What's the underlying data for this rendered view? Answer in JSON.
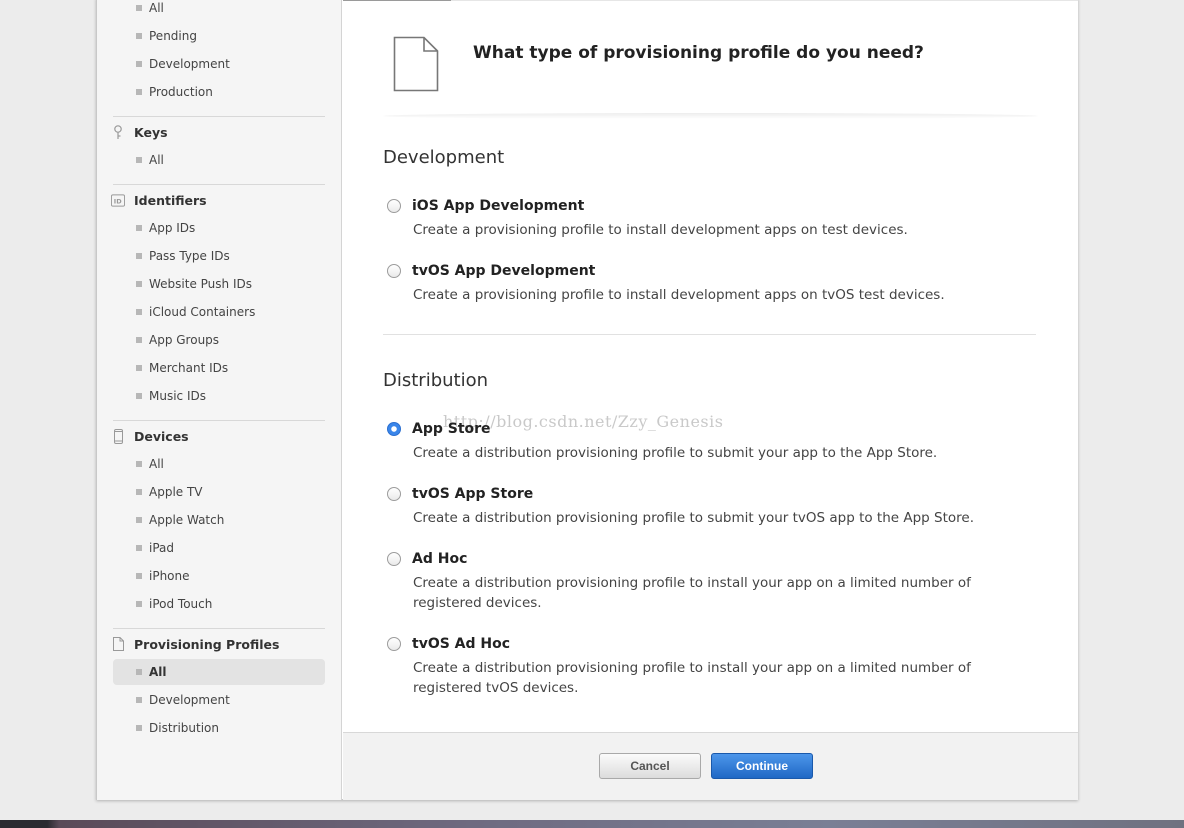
{
  "sidebar": {
    "top_items": [
      "All",
      "Pending",
      "Development",
      "Production"
    ],
    "keys": {
      "heading": "Keys",
      "icon": "key-icon",
      "items": [
        "All"
      ]
    },
    "identifiers": {
      "heading": "Identifiers",
      "icon": "id-badge-icon",
      "items": [
        "App IDs",
        "Pass Type IDs",
        "Website Push IDs",
        "iCloud Containers",
        "App Groups",
        "Merchant IDs",
        "Music IDs"
      ]
    },
    "devices": {
      "heading": "Devices",
      "icon": "device-icon",
      "items": [
        "All",
        "Apple TV",
        "Apple Watch",
        "iPad",
        "iPhone",
        "iPod Touch"
      ]
    },
    "profiles": {
      "heading": "Provisioning Profiles",
      "icon": "document-icon",
      "items": [
        "All",
        "Development",
        "Distribution"
      ],
      "selected": "All"
    }
  },
  "main": {
    "title": "What type of provisioning profile do you need?",
    "development": {
      "heading": "Development",
      "options": [
        {
          "title": "iOS App Development",
          "desc": "Create a provisioning profile to install development apps on test devices.",
          "checked": false
        },
        {
          "title": "tvOS App Development",
          "desc": "Create a provisioning profile to install development apps on tvOS test devices.",
          "checked": false
        }
      ]
    },
    "distribution": {
      "heading": "Distribution",
      "options": [
        {
          "title": "App Store",
          "desc": "Create a distribution provisioning profile to submit your app to the App Store.",
          "checked": true
        },
        {
          "title": "tvOS App Store",
          "desc": "Create a distribution provisioning profile to submit your tvOS app to the App Store.",
          "checked": false
        },
        {
          "title": "Ad Hoc",
          "desc": "Create a distribution provisioning profile to install your app on a limited number of registered devices.",
          "checked": false
        },
        {
          "title": "tvOS Ad Hoc",
          "desc": "Create a distribution provisioning profile to install your app on a limited number of registered tvOS devices.",
          "checked": false
        }
      ]
    },
    "watermark": "http://blog.csdn.net/Zzy_Genesis"
  },
  "footer": {
    "cancel_label": "Cancel",
    "continue_label": "Continue"
  },
  "colors": {
    "accent": "#1f68c5",
    "sidebar_bg": "#f5f5f5",
    "selected_bg": "#e3e3e3"
  }
}
